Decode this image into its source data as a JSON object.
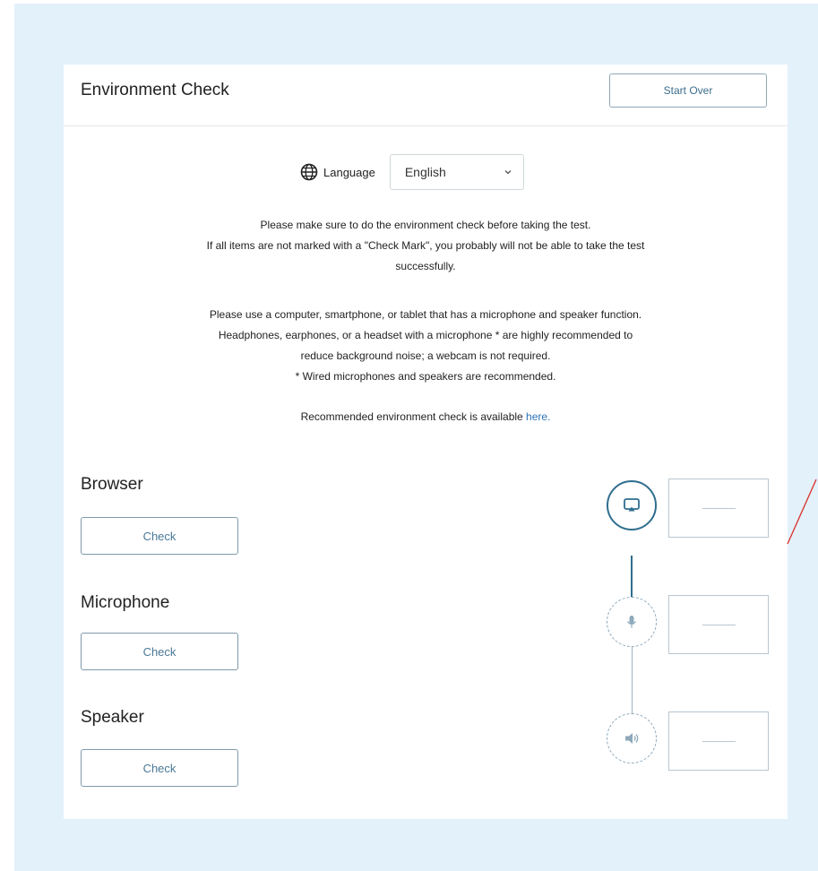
{
  "header": {
    "title": "Environment Check",
    "start_over_label": "Start Over"
  },
  "language": {
    "label": "Language",
    "selected": "English",
    "globe_icon": "globe-icon"
  },
  "instructions": {
    "p1": [
      "Please make sure to do the environment check before taking the test.",
      "If all items are not marked with a \"Check Mark\", you probably will not be able to take the test",
      "successfully."
    ],
    "p2": [
      "Please use a computer, smartphone, or tablet that has a microphone and speaker function.",
      "Headphones, earphones, or a headset with a microphone * are highly recommended to",
      "reduce background noise; a webcam is not required.",
      "* Wired microphones and speakers are recommended."
    ],
    "p3_text": "Recommended environment check is available ",
    "p3_link": "here."
  },
  "checks": [
    {
      "label": "Browser",
      "button": "Check",
      "icon": "screen-icon",
      "status": "—"
    },
    {
      "label": "Microphone",
      "button": "Check",
      "icon": "microphone-icon",
      "status": "—"
    },
    {
      "label": "Speaker",
      "button": "Check",
      "icon": "speaker-icon",
      "status": "—"
    }
  ],
  "colors": {
    "backdrop": "#e3f1fb",
    "accent": "#2f6e8f",
    "link": "#2f73b5",
    "annotation_line": "#d9302a"
  }
}
